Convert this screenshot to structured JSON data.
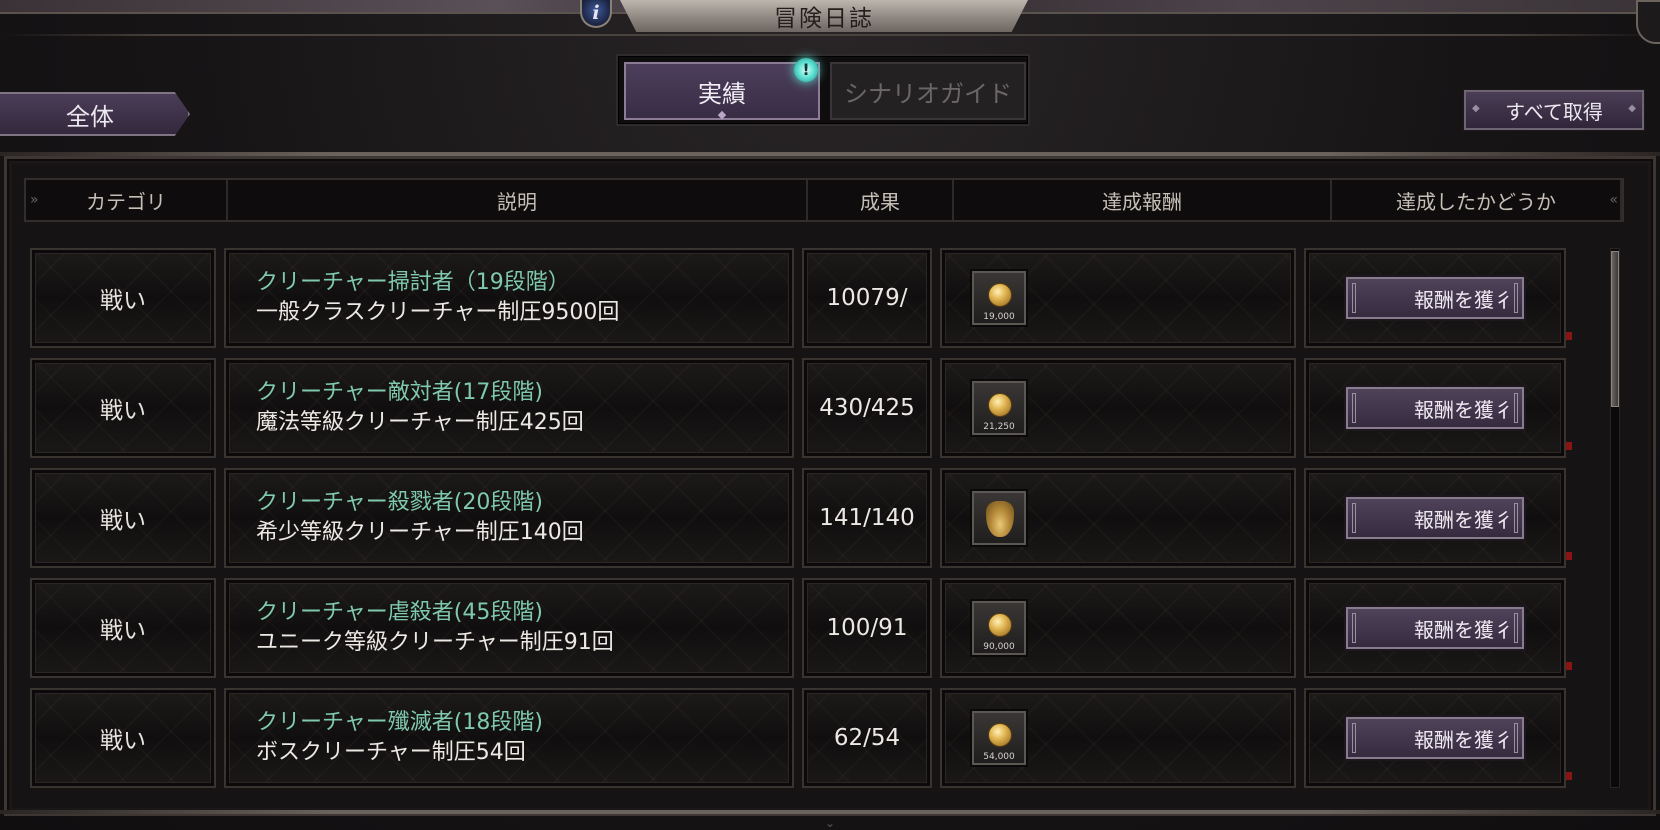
{
  "window": {
    "title": "冒険日誌",
    "info_icon": "info-icon"
  },
  "tabs": [
    {
      "label": "実績",
      "active": true
    },
    {
      "label": "シナリオガイド",
      "active": false
    }
  ],
  "tab_badge": "!",
  "filter": {
    "label": "全体"
  },
  "collect_all": {
    "label": "すべて取得"
  },
  "table": {
    "headers": {
      "category": "カテゴリ",
      "description": "説明",
      "result": "成果",
      "reward": "達成報酬",
      "completed": "達成したかどうか"
    },
    "rows": [
      {
        "category": "戦い",
        "title": "クリーチャー掃討者（19段階）",
        "desc": "一般クラスクリーチャー制圧9500回",
        "result": "10079/",
        "reward_icon": "gold-coin-icon",
        "reward_amount": "19,000",
        "button": "報酬を獲彳"
      },
      {
        "category": "戦い",
        "title": "クリーチャー敵対者(17段階)",
        "desc": "魔法等級クリーチャー制圧425回",
        "result": "430/425",
        "reward_icon": "gold-coin-icon",
        "reward_amount": "21,250",
        "button": "報酬を獲彳"
      },
      {
        "category": "戦い",
        "title": "クリーチャー殺戮者(20段階)",
        "desc": "希少等級クリーチャー制圧140回",
        "result": "141/140",
        "reward_icon": "gold-bag-icon",
        "reward_amount": "",
        "button": "報酬を獲彳"
      },
      {
        "category": "戦い",
        "title": "クリーチャー虐殺者(45段階)",
        "desc": "ユニーク等級クリーチャー制圧91回",
        "result": "100/91",
        "reward_icon": "gold-coin-icon",
        "reward_amount": "90,000",
        "button": "報酬を獲彳"
      },
      {
        "category": "戦い",
        "title": "クリーチャー殲滅者(18段階)",
        "desc": "ボスクリーチャー制圧54回",
        "result": "62/54",
        "reward_icon": "gold-coin-icon",
        "reward_amount": "54,000",
        "button": "報酬を獲彳"
      }
    ]
  },
  "colors": {
    "accent_purple": "#4d3f5c",
    "title_green": "#7fc9ae",
    "badge_cyan": "#5fe3d4"
  }
}
